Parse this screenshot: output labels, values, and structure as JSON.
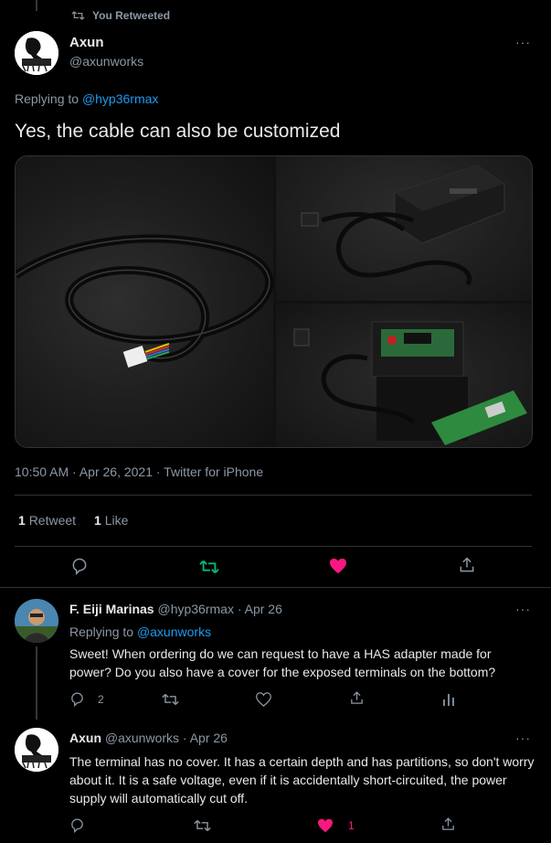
{
  "retweet_banner": {
    "label": "You Retweeted"
  },
  "main_tweet": {
    "author_name": "Axun",
    "handle": "@axunworks",
    "replying_prefix": "Replying to",
    "replying_handle": "@hyp36rmax",
    "text": "Yes, the cable can also be customized",
    "timestamp": "10:50 AM · Apr 26, 2021 · Twitter for iPhone",
    "stats": {
      "retweets_count": "1",
      "retweets_label": "Retweet",
      "likes_count": "1",
      "likes_label": "Like"
    },
    "more_label": "···"
  },
  "reply_1": {
    "author_name": "F. Eiji Marinas",
    "handle_time": "@hyp36rmax · Apr 26",
    "replying_prefix": "Replying to",
    "replying_handle": "@axunworks",
    "text": "Sweet! When ordering do we can request to have a HAS adapter made for power? Do you also have a cover for the exposed terminals on the bottom?",
    "reply_count": "2",
    "more_label": "···"
  },
  "reply_2": {
    "author_name": "Axun",
    "handle_time": "@axunworks · Apr 26",
    "text": "The terminal has no cover. It has a certain depth and has partitions, so don't worry about it. It is a safe voltage, even if it is accidentally short-circuited, the power supply will automatically cut off.",
    "like_count": "1",
    "more_label": "···"
  },
  "colors": {
    "accent": "#1d9bf0",
    "retweet_active": "#00ba7c",
    "like_active": "#f91880",
    "background": "#000000"
  },
  "icons": [
    "retweet-icon",
    "reply-icon",
    "like-icon",
    "share-icon",
    "analytics-icon",
    "more-icon"
  ]
}
